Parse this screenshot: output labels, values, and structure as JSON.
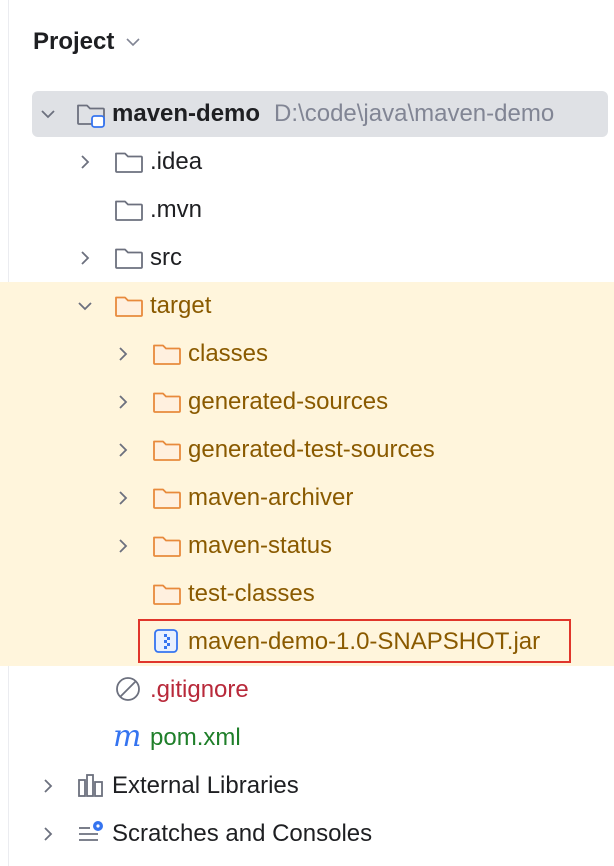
{
  "panel": {
    "title": "Project",
    "title_icon": "chevron-down-icon"
  },
  "tree": {
    "root": {
      "label": "maven-demo",
      "path": "D:\\code\\java\\maven-demo",
      "icon": "module-folder-icon",
      "expanded": true
    },
    "idea": {
      "label": ".idea",
      "icon": "folder-icon",
      "expanded": false
    },
    "mvn": {
      "label": ".mvn",
      "icon": "folder-icon"
    },
    "src": {
      "label": "src",
      "icon": "folder-icon",
      "expanded": false
    },
    "target": {
      "label": "target",
      "icon": "excluded-folder-icon",
      "expanded": true
    },
    "target_children": [
      {
        "label": "classes",
        "icon": "excluded-folder-icon",
        "has_children": true
      },
      {
        "label": "generated-sources",
        "icon": "excluded-folder-icon",
        "has_children": true
      },
      {
        "label": "generated-test-sources",
        "icon": "excluded-folder-icon",
        "has_children": true
      },
      {
        "label": "maven-archiver",
        "icon": "excluded-folder-icon",
        "has_children": true
      },
      {
        "label": "maven-status",
        "icon": "excluded-folder-icon",
        "has_children": true
      },
      {
        "label": "test-classes",
        "icon": "excluded-folder-icon",
        "has_children": false
      },
      {
        "label": "maven-demo-1.0-SNAPSHOT.jar",
        "icon": "jar-file-icon",
        "has_children": false
      }
    ],
    "gitignore": {
      "label": ".gitignore",
      "icon": "ignored-file-icon"
    },
    "pom": {
      "label": "pom.xml",
      "icon": "maven-icon"
    },
    "external_libraries": {
      "label": "External Libraries",
      "icon": "libraries-icon"
    },
    "scratches": {
      "label": "Scratches and Consoles",
      "icon": "scratches-icon"
    }
  },
  "colors": {
    "highlight_bg": "#fff5dc",
    "selected_bg": "#dfe1e5",
    "excluded_text": "#8a5a00",
    "ignored_text": "#b8293a",
    "maven_text": "#1f7f2a",
    "annotation_border": "#e0352b"
  }
}
